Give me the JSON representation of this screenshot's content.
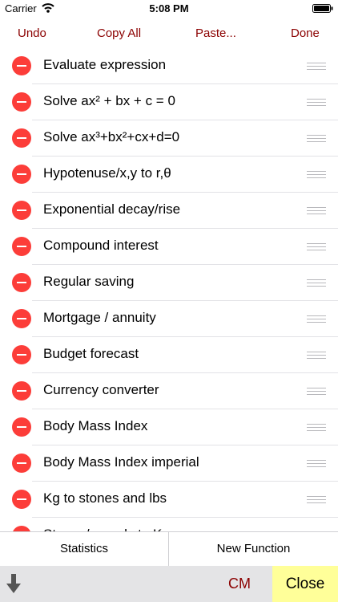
{
  "status": {
    "carrier": "Carrier",
    "time": "5:08 PM"
  },
  "toolbar": {
    "undo": "Undo",
    "copy_all": "Copy All",
    "paste": "Paste...",
    "done": "Done"
  },
  "functions": [
    "Evaluate expression",
    "Solve ax² + bx + c = 0",
    "Solve ax³+bx²+cx+d=0",
    "Hypotenuse/x,y to r,θ",
    "Exponential decay/rise",
    "Compound interest",
    "Regular saving",
    "Mortgage / annuity",
    "Budget forecast",
    "Currency converter",
    "Body Mass Index",
    "Body Mass Index imperial",
    "Kg to stones and lbs",
    "Stones/pounds to Kg"
  ],
  "footer": {
    "statistics": "Statistics",
    "new_function": "New Function"
  },
  "bottom": {
    "cm": "CM",
    "close": "Close"
  },
  "icons": {
    "delete": "minus-circle-icon",
    "reorder": "reorder-grip-icon",
    "download": "arrow-down-icon"
  },
  "colors": {
    "accent": "#8b0000",
    "delete": "#fc3d39",
    "close_bg": "#ffff99"
  }
}
